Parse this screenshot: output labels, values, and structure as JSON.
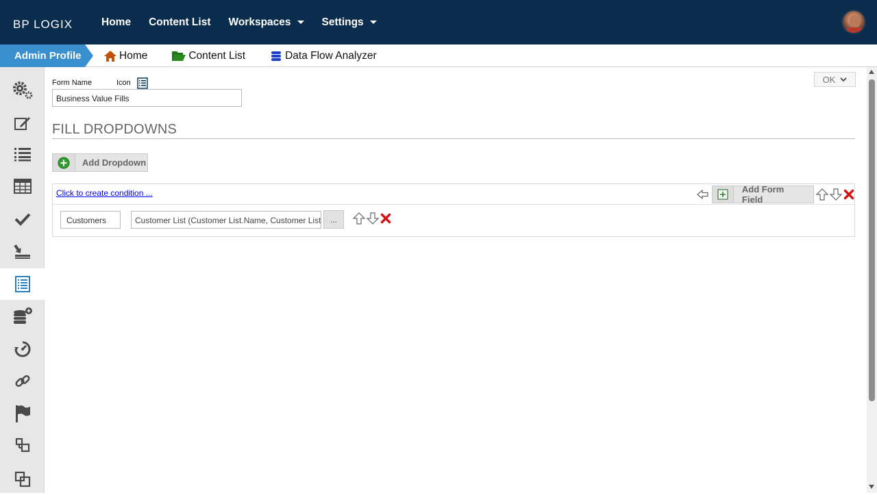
{
  "header": {
    "logo_text": "BP LOGIX",
    "nav": [
      {
        "label": "Home",
        "has_caret": false
      },
      {
        "label": "Content List",
        "has_caret": false
      },
      {
        "label": "Workspaces",
        "has_caret": true
      },
      {
        "label": "Settings",
        "has_caret": true
      }
    ],
    "colors": {
      "bar": "#0b2d4d",
      "text": "#ffffff"
    }
  },
  "breadcrumb": {
    "profile_label": "Admin Profile",
    "links": [
      {
        "label": "Home",
        "icon": "home-icon"
      },
      {
        "label": "Content List",
        "icon": "folder-open-icon"
      },
      {
        "label": "Data Flow Analyzer",
        "icon": "database-icon"
      }
    ],
    "colors": {
      "profile_tab": "#3a8fcf"
    }
  },
  "sidebar": {
    "items": [
      {
        "icon": "gears-icon",
        "active": false
      },
      {
        "icon": "edit-icon",
        "active": false
      },
      {
        "icon": "list-icon",
        "active": false
      },
      {
        "icon": "table-icon",
        "active": false
      },
      {
        "icon": "check-icon",
        "active": false
      },
      {
        "icon": "import-icon",
        "active": false
      },
      {
        "icon": "form-list-icon",
        "active": true
      },
      {
        "icon": "database-add-icon",
        "active": false
      },
      {
        "icon": "timer-icon",
        "active": false
      },
      {
        "icon": "link-icon",
        "active": false
      },
      {
        "icon": "flag-icon",
        "active": false
      },
      {
        "icon": "hierarchy-icon",
        "active": false
      },
      {
        "icon": "copy-icon",
        "active": false
      }
    ]
  },
  "form": {
    "form_name_label": "Form Name",
    "icon_label": "Icon",
    "form_name_value": "Business Value Fills",
    "ok_label": "OK",
    "section_title": "FILL DROPDOWNS",
    "add_dropdown_label": "Add Dropdown"
  },
  "panel": {
    "condition_link": "Click to create condition ...",
    "add_form_field_label": "Add Form Field",
    "rows": [
      {
        "field": "Customers",
        "source": "Customer List (Customer List.Name, Customer List.Id)",
        "more_label": "..."
      }
    ]
  }
}
